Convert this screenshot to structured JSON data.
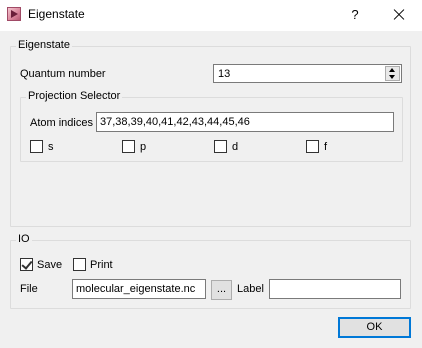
{
  "window": {
    "title": "Eigenstate",
    "help_glyph": "?",
    "icon": "app-icon",
    "close_icon": "close-icon"
  },
  "eigenstate_group": {
    "title": "Eigenstate",
    "quantum_label": "Quantum number",
    "quantum_value": "13",
    "projection_group": {
      "title": "Projection Selector",
      "atom_indices_label": "Atom indices",
      "atom_indices_value": "37,38,39,40,41,42,43,44,45,46",
      "orbitals": [
        {
          "label": "s",
          "checked": false
        },
        {
          "label": "p",
          "checked": false
        },
        {
          "label": "d",
          "checked": false
        },
        {
          "label": "f",
          "checked": false
        }
      ]
    }
  },
  "io_group": {
    "title": "IO",
    "save_label": "Save",
    "save_checked": true,
    "print_label": "Print",
    "print_checked": false,
    "file_label": "File",
    "file_value": "molecular_eigenstate.nc",
    "browse_label": "...",
    "label_label": "Label",
    "label_value": ""
  },
  "ok_label": "OK",
  "colors": {
    "dialog_bg": "#f0f0f0",
    "focus_border": "#0078d7"
  }
}
